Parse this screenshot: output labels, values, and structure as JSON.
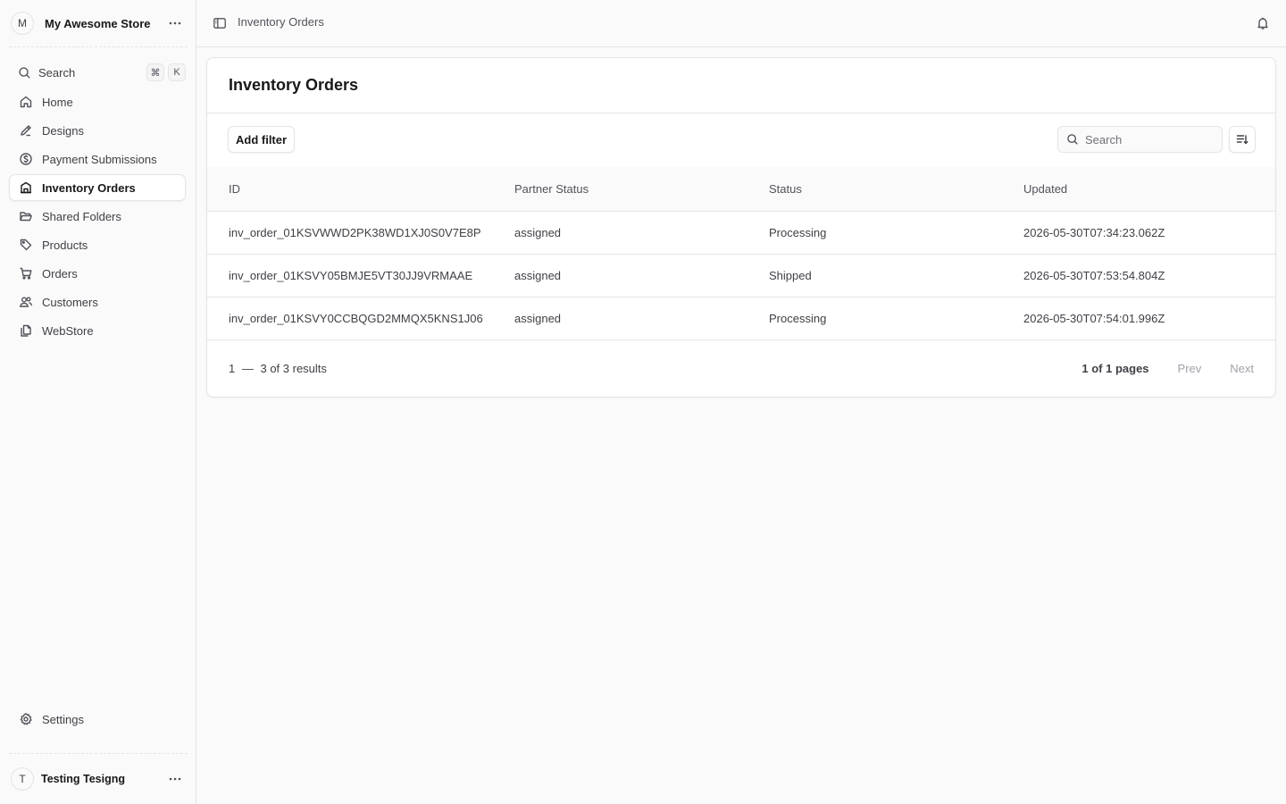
{
  "store": {
    "avatar_letter": "M",
    "name": "My Awesome Store",
    "menu_icon": "more-horizontal-icon"
  },
  "search": {
    "label": "Search",
    "shortcut_mod": "⌘",
    "shortcut_key": "K"
  },
  "sidebar": {
    "items": [
      {
        "label": "Home",
        "icon": "home-icon"
      },
      {
        "label": "Designs",
        "icon": "pencil-icon"
      },
      {
        "label": "Payment Submissions",
        "icon": "dollar-circle-icon"
      },
      {
        "label": "Inventory Orders",
        "icon": "building-icon",
        "active": true
      },
      {
        "label": "Shared Folders",
        "icon": "folder-open-icon"
      },
      {
        "label": "Products",
        "icon": "tag-icon"
      },
      {
        "label": "Orders",
        "icon": "cart-icon"
      },
      {
        "label": "Customers",
        "icon": "users-icon"
      },
      {
        "label": "WebStore",
        "icon": "copy-icon"
      }
    ],
    "settings_label": "Settings"
  },
  "user": {
    "avatar_letter": "T",
    "name": "Testing Tesigng"
  },
  "topbar": {
    "breadcrumb": "Inventory Orders"
  },
  "page": {
    "title": "Inventory Orders",
    "add_filter_label": "Add filter",
    "search_placeholder": "Search"
  },
  "table": {
    "columns": [
      "ID",
      "Partner Status",
      "Status",
      "Updated"
    ],
    "rows": [
      [
        "inv_order_01KSVWWD2PK38WD1XJ0S0V7E8P",
        "assigned",
        "Processing",
        "2026-05-30T07:34:23.062Z"
      ],
      [
        "inv_order_01KSVY05BMJE5VT30JJ9VRMAAE",
        "assigned",
        "Shipped",
        "2026-05-30T07:53:54.804Z"
      ],
      [
        "inv_order_01KSVY0CCBQGD2MMQX5KNS1J06",
        "assigned",
        "Processing",
        "2026-05-30T07:54:01.996Z"
      ]
    ]
  },
  "pagination": {
    "range_start": "1",
    "range_sep": "—",
    "range_rest": "3 of 3 results",
    "pages": "1 of 1 pages",
    "prev": "Prev",
    "next": "Next"
  },
  "colors": {
    "border": "#e4e4e7",
    "background": "#fafafa",
    "text": "#18181b",
    "muted": "#71717a",
    "disabled": "#a1a1aa"
  }
}
